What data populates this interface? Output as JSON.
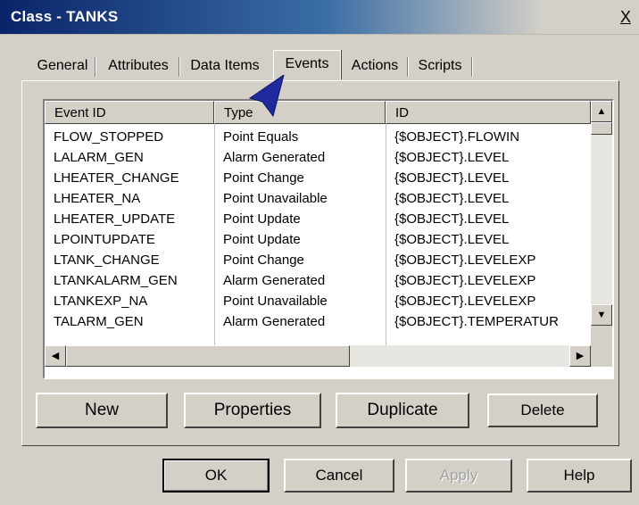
{
  "window": {
    "title": "Class - TANKS",
    "close_glyph": "X"
  },
  "tabs": [
    {
      "label": "General"
    },
    {
      "label": "Attributes"
    },
    {
      "label": "Data Items"
    },
    {
      "label": "Events"
    },
    {
      "label": "Actions"
    },
    {
      "label": "Scripts"
    }
  ],
  "active_tab": "Events",
  "list": {
    "columns": [
      "Event ID",
      "Type",
      "ID"
    ],
    "rows": [
      [
        "FLOW_STOPPED",
        "Point Equals",
        "{$OBJECT}.FLOWIN"
      ],
      [
        "LALARM_GEN",
        "Alarm Generated",
        "{$OBJECT}.LEVEL"
      ],
      [
        "LHEATER_CHANGE",
        "Point Change",
        "{$OBJECT}.LEVEL"
      ],
      [
        "LHEATER_NA",
        "Point Unavailable",
        "{$OBJECT}.LEVEL"
      ],
      [
        "LHEATER_UPDATE",
        "Point Update",
        "{$OBJECT}.LEVEL"
      ],
      [
        "LPOINTUPDATE",
        "Point Update",
        "{$OBJECT}.LEVEL"
      ],
      [
        "LTANK_CHANGE",
        "Point Change",
        "{$OBJECT}.LEVELEXP"
      ],
      [
        "LTANKALARM_GEN",
        "Alarm Generated",
        "{$OBJECT}.LEVELEXP"
      ],
      [
        "LTANKEXP_NA",
        "Point Unavailable",
        "{$OBJECT}.LEVELEXP"
      ],
      [
        "TALARM_GEN",
        "Alarm Generated",
        "{$OBJECT}.TEMPERATUR"
      ]
    ],
    "scroll_up_glyph": "▲",
    "scroll_down_glyph": "▼",
    "scroll_left_glyph": "◀",
    "scroll_right_glyph": "▶"
  },
  "actions": {
    "new_label": "New",
    "properties_label": "Properties",
    "duplicate_label": "Duplicate",
    "delete_label": "Delete"
  },
  "footer": {
    "ok_label": "OK",
    "cancel_label": "Cancel",
    "apply_label": "Apply",
    "help_label": "Help"
  },
  "colors": {
    "face": "#d4d0c8",
    "title_bar": "#0a246a",
    "cursor": "#1f2a9e"
  },
  "icons": {
    "pointer": "arrow-cursor-icon"
  }
}
